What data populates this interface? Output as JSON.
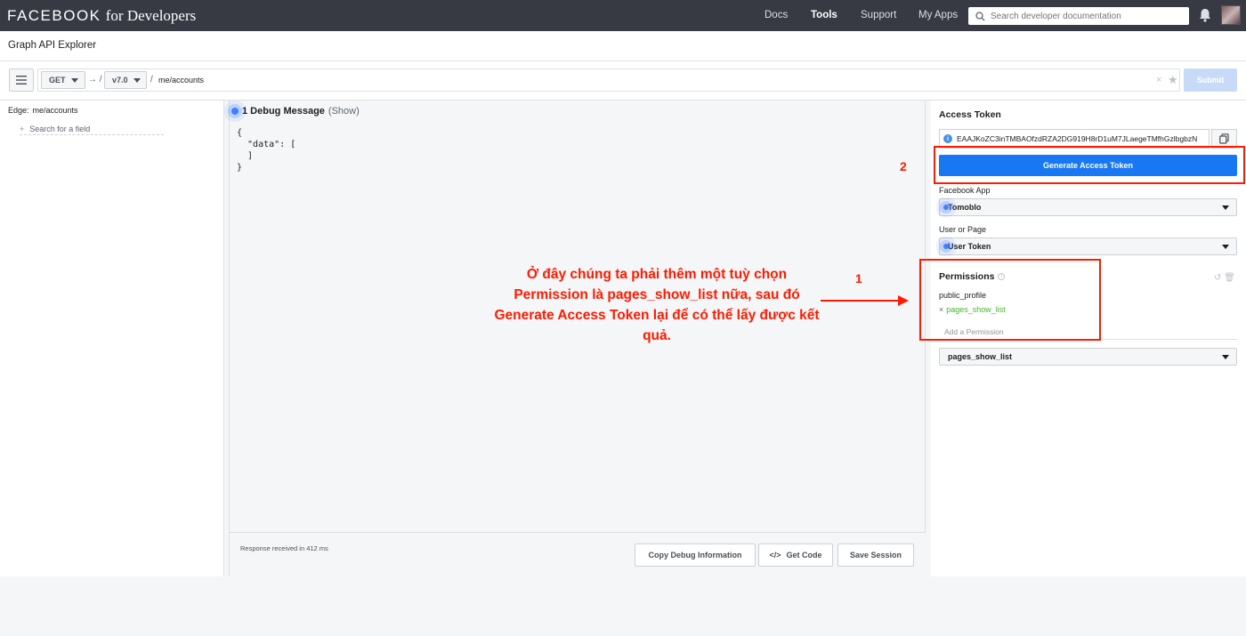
{
  "topbar": {
    "brand_main": "FACEBOOK",
    "brand_sub": "for Developers",
    "nav": [
      "Docs",
      "Tools",
      "Support",
      "My Apps"
    ],
    "search_placeholder": "Search developer documentation"
  },
  "page": {
    "title": "Graph API Explorer"
  },
  "request": {
    "method": "GET",
    "version": "v7.0",
    "arrow": "→ /",
    "slash": "/",
    "path": "me/accounts",
    "submit_label": "Submit"
  },
  "left_panel": {
    "edge_label": "Edge:",
    "edge_value": "me/accounts",
    "field_search_placeholder": "Search for a field"
  },
  "debug": {
    "title": "1 Debug Message",
    "show_label": "(Show)",
    "response_json": "{\n  \"data\": [\n  ]\n}",
    "response_status": "Response received in 412 ms",
    "buttons": {
      "copy": "Copy Debug Information",
      "get_code": "Get Code",
      "save": "Save Session"
    },
    "get_code_icon": "</>"
  },
  "right_panel": {
    "access_token_label": "Access Token",
    "token_value": "EAAJKoZC3inTMBAOfzdRZA2DG919H8rD1uM7JLaegeTMfhGzlbgbzN",
    "generate_label": "Generate Access Token",
    "facebook_app_label": "Facebook App",
    "facebook_app_value": "Tomoblo",
    "user_or_page_label": "User or Page",
    "user_or_page_value": "User Token",
    "permissions_label": "Permissions",
    "permissions": [
      "public_profile",
      "pages_show_list"
    ],
    "add_permission_placeholder": "Add a Permission",
    "permission_select_value": "pages_show_list"
  },
  "annotations": {
    "num1": "1",
    "num2": "2",
    "note": "Ở đây chúng ta phải thêm một tuỳ chọn Permission là pages_show_list nữa, sau đó Generate Access Token lại để có thể lấy được kết quả.",
    "color": "#ff1a00"
  },
  "colors": {
    "primary": "#1877f2",
    "green": "#42b72a",
    "topbar": "#373a43"
  }
}
